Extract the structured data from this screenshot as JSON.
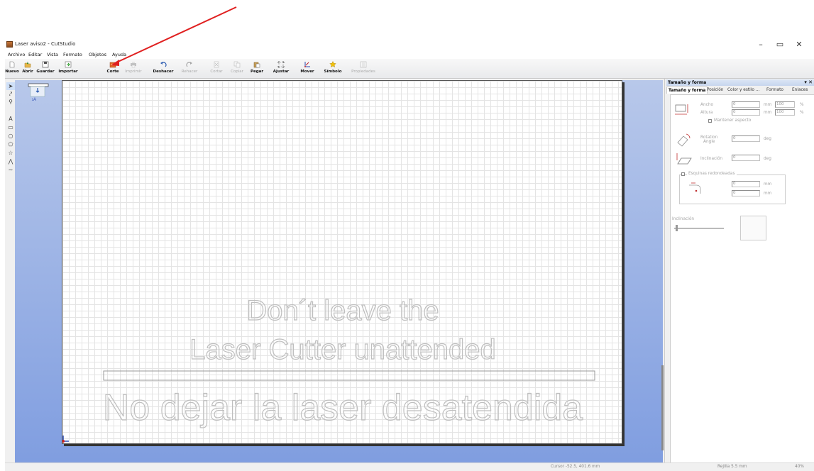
{
  "window": {
    "title": "Laser aviso2 - CutStudio",
    "minimize": "–",
    "restore": "▭",
    "close": "✕"
  },
  "menu": [
    "Archivo",
    "Editar",
    "Vista",
    "Formato",
    "Objetos",
    "Ayuda"
  ],
  "toolbar": [
    {
      "label": "Nuevo",
      "icon": "new-file-icon",
      "enabled": true
    },
    {
      "label": "Abrir",
      "icon": "open-folder-icon",
      "enabled": true
    },
    {
      "label": "Guardar",
      "icon": "save-disk-icon",
      "enabled": true
    },
    {
      "label": "Importar",
      "icon": "import-icon",
      "enabled": true
    },
    {
      "label": "Corte",
      "icon": "cut-plotter-icon",
      "enabled": true
    },
    {
      "label": "Imprimir",
      "icon": "printer-icon",
      "enabled": false
    },
    {
      "label": "Deshacer",
      "icon": "undo-icon",
      "enabled": true
    },
    {
      "label": "Rehacer",
      "icon": "redo-icon",
      "enabled": false
    },
    {
      "label": "Cortar",
      "icon": "cut-icon",
      "enabled": false
    },
    {
      "label": "Copiar",
      "icon": "copy-icon",
      "enabled": false
    },
    {
      "label": "Pegar",
      "icon": "paste-icon",
      "enabled": true
    },
    {
      "label": "Ajustar",
      "icon": "fit-icon",
      "enabled": true
    },
    {
      "label": "Mover",
      "icon": "move-origin-icon",
      "enabled": true
    },
    {
      "label": "Símbolo",
      "icon": "star-symbol-icon",
      "enabled": true
    },
    {
      "label": "Propiedades",
      "icon": "properties-icon",
      "enabled": false
    }
  ],
  "tools": [
    "select-arrow-icon",
    "node-edit-icon",
    "zoom-icon",
    "text-tool-icon",
    "rectangle-icon",
    "ellipse-icon",
    "polygon-icon",
    "star-icon",
    "polyline-icon",
    "curve-icon"
  ],
  "tool_glyphs": [
    "➤",
    "⤤",
    "⚲",
    "A",
    "▭",
    "○",
    "⬠",
    "☆",
    "⋀",
    "∼"
  ],
  "canvas": {
    "line1": "Don´t leave the",
    "line2": "Laser Cutter unattended",
    "line3": "No dejar la laser desatendida"
  },
  "panel": {
    "title": "Tamaño y forma",
    "pin": "▾ ✕",
    "tabs": [
      "Tamaño y forma",
      "Posición",
      "Color y estilo ...",
      "Formato",
      "Enlaces"
    ],
    "ancho_label": "Ancho",
    "alto_label": "Altura",
    "ancho_value": "0",
    "alto_value": "0",
    "ancho_pct": "100",
    "alto_pct": "100",
    "unit_mm": "mm",
    "unit_pct": "%",
    "keep_aspect": "Mantener aspecto",
    "rotation_label": "Rotation",
    "rotation_sub": "Angle",
    "rotation_value": "0",
    "unit_deg": "deg",
    "inclinacion_label": "Inclinación",
    "inclinacion_value": "0",
    "rounded_label": "Esquinas redondeadas",
    "rounded_value1": "0",
    "rounded_value2": "0",
    "slider_label": "Inclinación"
  },
  "status": {
    "cursor": "Cursor -52.5, 401.6 mm",
    "rejilla": "Rejilla 5.5 mm",
    "zoom": "40%"
  },
  "colors": {
    "annotation_arrow": "#e02020",
    "workarea": "#7f9de0",
    "outline_text": "#bfbfbf"
  }
}
